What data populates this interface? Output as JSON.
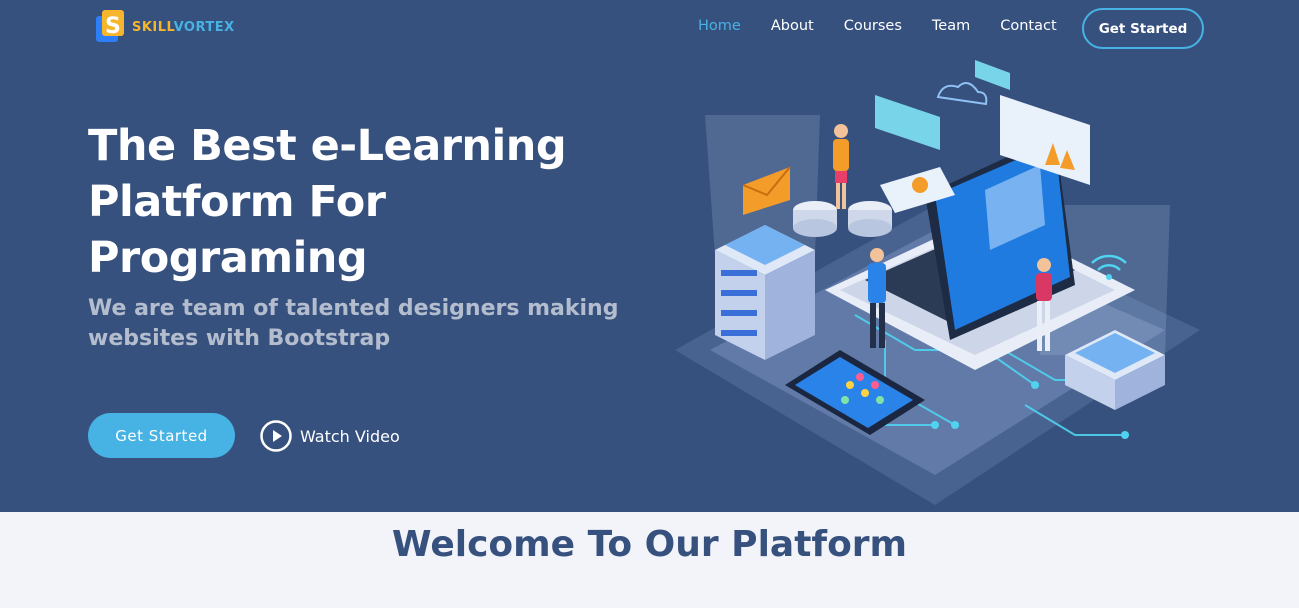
{
  "brand": {
    "name_part1": "SKILL",
    "name_part2": "VORTEX",
    "colors": {
      "primary": "#37517e",
      "accent": "#47b2e4",
      "logo_yellow": "#f7b52b"
    }
  },
  "nav": {
    "items": [
      {
        "label": "Home",
        "active": true
      },
      {
        "label": "About",
        "active": false
      },
      {
        "label": "Courses",
        "active": false
      },
      {
        "label": "Team",
        "active": false
      },
      {
        "label": "Contact",
        "active": false
      }
    ],
    "cta_label": "Get Started"
  },
  "hero": {
    "title": "The Best e-Learning Platform For Programing",
    "subtitle": "We are team of talented designers making websites with Bootstrap",
    "primary_button": "Get Started",
    "secondary_button": "Watch Video",
    "icons": {
      "play": "play-circle-icon"
    }
  },
  "section": {
    "title": "Welcome To Our Platform"
  }
}
